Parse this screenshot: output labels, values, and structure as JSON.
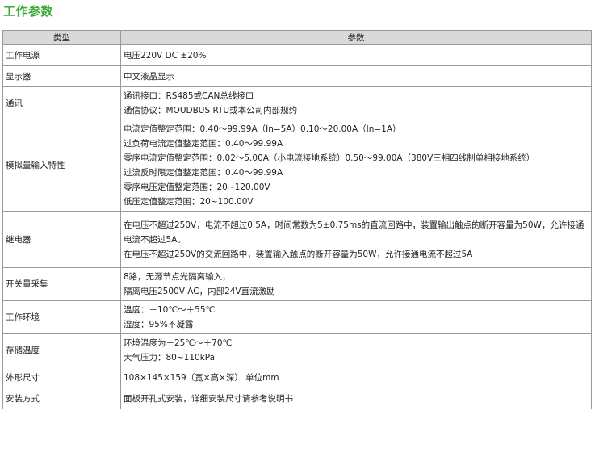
{
  "title": "工作参数",
  "headers": {
    "type": "类型",
    "params": "参数"
  },
  "rows": [
    {
      "category": "工作电源",
      "lines": [
        "电压220V DC ±20%"
      ]
    },
    {
      "category": "显示器",
      "lines": [
        "中文液晶显示"
      ]
    },
    {
      "category": "通讯",
      "lines": [
        "通讯接口：RS485或CAN总线接口",
        "通信协议：MOUDBUS RTU或本公司内部规约"
      ]
    },
    {
      "category": "模拟量输入特性",
      "lines": [
        "电流定值整定范围：0.40～99.99A（In=5A）0.10～20.00A（In=1A）",
        "过负荷电流定值整定范围：0.40～99.99A",
        "零序电流定值整定范围：0.02～5.00A（小电流接地系统）0.50～99.00A（380V三相四线制单相接地系统）",
        "过流反时限定值整定范围：0.40～99.99A",
        "零序电压定值整定范围：20~120.00V",
        "低压定值整定范围：20~100.00V"
      ]
    },
    {
      "category": "继电器",
      "lines": [
        "在电压不超过250V，电流不超过0.5A，时间常数为5±0.75ms的直流回路中，装置输出触点的断开容量为50W，允许接通电流不超过5A。",
        "在电压不超过250V的交流回路中，装置输入触点的断开容量为50W，允许接通电流不超过5A"
      ]
    },
    {
      "category": "开关量采集",
      "lines": [
        "8路，无源节点光隔离输入，",
        "隔离电压2500V AC，内部24V直流激励"
      ]
    },
    {
      "category": "工作环境",
      "lines": [
        "温度：－10℃～＋55℃",
        "湿度：95%不凝露"
      ]
    },
    {
      "category": "存储温度",
      "lines": [
        "环境温度为－25℃～＋70℃",
        "大气压力：80~110kPa"
      ]
    },
    {
      "category": "外形尺寸",
      "lines": [
        "108×145×159（宽×高×深） 单位mm"
      ]
    },
    {
      "category": "安装方式",
      "lines": [
        "面板开孔式安装，详细安装尺寸请参考说明书"
      ]
    }
  ]
}
